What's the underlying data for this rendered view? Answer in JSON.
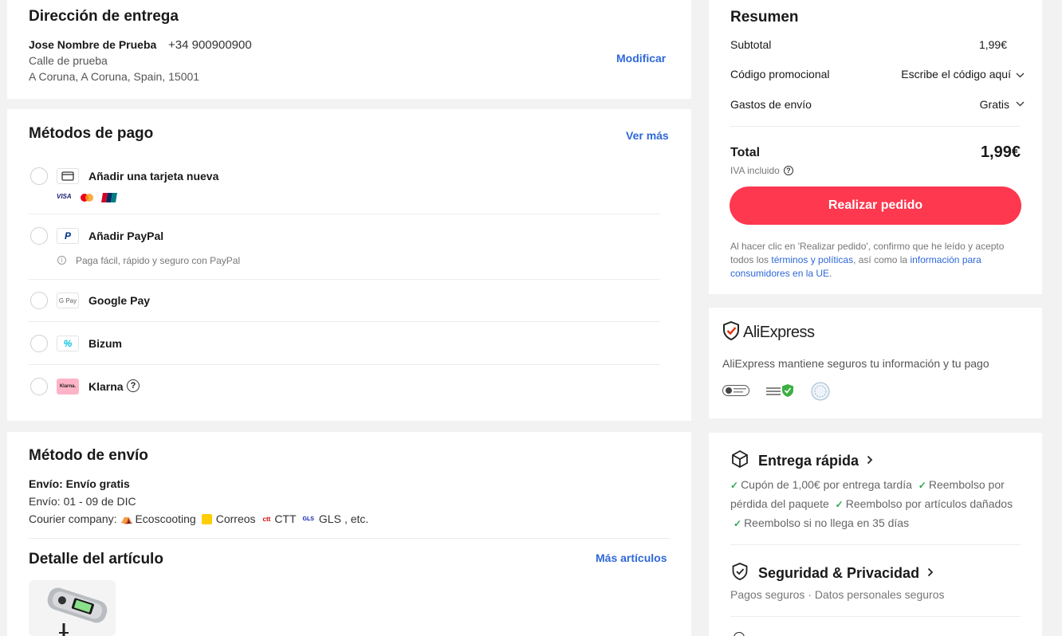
{
  "address": {
    "title": "Dirección de entrega",
    "name": "Jose Nombre de Prueba",
    "phone": "+34 900900900",
    "street": "Calle de prueba",
    "city": "A Coruna, A Coruna, Spain, 15001",
    "modify": "Modificar"
  },
  "payment": {
    "title": "Métodos de pago",
    "see_more": "Ver más",
    "card_label": "Añadir una tarjeta nueva",
    "card_brands": [
      "VISA",
      "mastercard",
      "UnionPay"
    ],
    "paypal_label": "Añadir PayPal",
    "paypal_note": "Paga fácil, rápido y seguro con PayPal",
    "gpay_label": "Google Pay",
    "gpay_icon_text": "G Pay",
    "bizum_label": "Bizum",
    "klarna_label": "Klarna",
    "klarna_icon_text": "Klarna."
  },
  "shipping": {
    "title": "Método de envío",
    "method": "Envío: Envío gratis",
    "dates": "Envío: 01 - 09 de DIC",
    "courier_label": "Courier company:",
    "couriers": [
      "Ecoscooting",
      "Correos",
      "CTT",
      "GLS"
    ],
    "etc": ", etc."
  },
  "items": {
    "title": "Detalle del artículo",
    "more": "Más artículos"
  },
  "summary": {
    "title": "Resumen",
    "subtotal_label": "Subtotal",
    "subtotal_value": "1,99€",
    "promo_label": "Código promocional",
    "promo_value": "Escribe el código aquí",
    "shipping_label": "Gastos de envío",
    "shipping_value": "Gratis",
    "total_label": "Total",
    "total_value": "1,99€",
    "vat_note": "IVA incluido",
    "order_button": "Realizar pedido",
    "legal_1": "Al hacer clic en 'Realizar pedido', confirmo que he leído y acepto todos los ",
    "legal_link_1": "términos y políticas",
    "legal_2": ", así como la ",
    "legal_link_2": "información para consumidores en la UE",
    "legal_3": "."
  },
  "trust": {
    "brand": "AliExpress",
    "text": "AliExpress mantiene seguros tu información y tu pago"
  },
  "delivery": {
    "title": "Entrega rápida",
    "benefit_1": "Cupón de 1,00€ por entrega tardía",
    "benefit_2": "Reembolso por pérdida del paquete",
    "benefit_3": "Reembolso por artículos dañados",
    "benefit_4": "Reembolso si no llega en 35 días"
  },
  "security": {
    "title": "Seguridad & Privacidad",
    "text": "Pagos seguros · Datos personales seguros"
  },
  "colors": {
    "accent_red": "#fd384f",
    "link_blue": "#2e68d9",
    "check_green": "#2aa653",
    "background": "#f2f2f2"
  }
}
